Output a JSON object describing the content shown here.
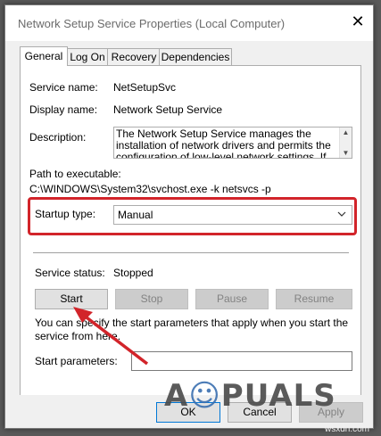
{
  "window": {
    "title": "Network Setup Service Properties (Local Computer)",
    "close_icon": "close-icon"
  },
  "tabs": [
    {
      "label": "General",
      "active": true
    },
    {
      "label": "Log On"
    },
    {
      "label": "Recovery"
    },
    {
      "label": "Dependencies"
    }
  ],
  "general": {
    "service_name_label": "Service name:",
    "service_name_value": "NetSetupSvc",
    "display_name_label": "Display name:",
    "display_name_value": "Network Setup Service",
    "description_label": "Description:",
    "description_value": "The Network Setup Service manages the installation of network drivers and permits the configuration of low-level network settings.  If this service is stopped",
    "path_label": "Path to executable:",
    "path_value": "C:\\WINDOWS\\System32\\svchost.exe -k netsvcs -p",
    "startup_type_label": "Startup type:",
    "startup_type_value": "Manual",
    "service_status_label": "Service status:",
    "service_status_value": "Stopped",
    "start_label": "Start",
    "stop_label": "Stop",
    "pause_label": "Pause",
    "resume_label": "Resume",
    "hint_text": "You can specify the start parameters that apply when you start the service from here.",
    "start_parameters_label": "Start parameters:",
    "start_parameters_value": ""
  },
  "footer": {
    "ok_label": "OK",
    "cancel_label": "Cancel",
    "apply_label": "Apply"
  },
  "overlay": {
    "logo_text": "APPUALS",
    "watermark": "wsxdn.com",
    "highlight_color": "#d2242a"
  }
}
